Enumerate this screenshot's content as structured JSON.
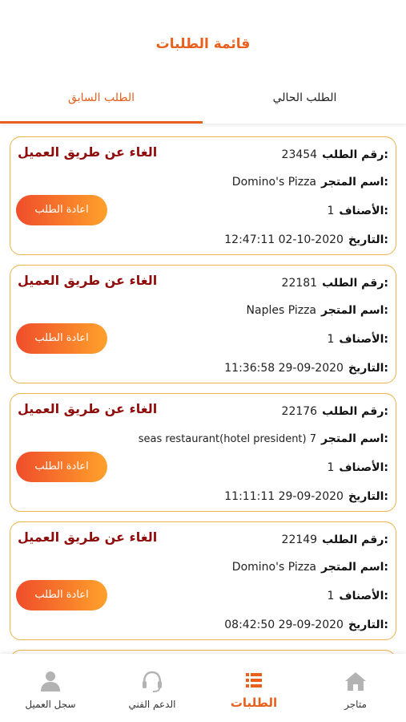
{
  "header": {
    "title": "قائمة الطلبات"
  },
  "tabs": [
    {
      "label": "الطلب السابق",
      "active": true
    },
    {
      "label": "الطلب الحالي",
      "active": false
    }
  ],
  "labels": {
    "order_number": "رقم الطلب:",
    "store_name": "اسم المتجر:",
    "items": "الأصناف:",
    "date": "التاريخ:",
    "reorder_button": "اعادة الطلب"
  },
  "orders": [
    {
      "number": "23454",
      "store": "Domino's Pizza",
      "items": "1",
      "date": "12:47:11 02-10-2020",
      "status": "الغاء عن طريق العميل"
    },
    {
      "number": "22181",
      "store": "Naples Pizza",
      "items": "1",
      "date": "11:36:58 29-09-2020",
      "status": "الغاء عن طريق العميل"
    },
    {
      "number": "22176",
      "store": "seas restaurant(hotel president) 7",
      "items": "1",
      "date": "11:11:11 29-09-2020",
      "status": "الغاء عن طريق العميل"
    },
    {
      "number": "22149",
      "store": "Domino's Pizza",
      "items": "1",
      "date": "08:42:50 29-09-2020",
      "status": "الغاء عن طريق العميل"
    }
  ],
  "bottom_nav": [
    {
      "label": "سجل العميل",
      "icon": "user-icon"
    },
    {
      "label": "الدعم الفني",
      "icon": "headset-icon"
    },
    {
      "label": "الطلبات",
      "icon": "list-icon",
      "active": true
    },
    {
      "label": "متاجر",
      "icon": "home-icon"
    }
  ],
  "colors": {
    "accent": "#e8601c",
    "card_border": "#f1b24a",
    "status": "#8f0c0c",
    "button_from": "#ef4d2b",
    "button_to": "#ffa12b"
  }
}
